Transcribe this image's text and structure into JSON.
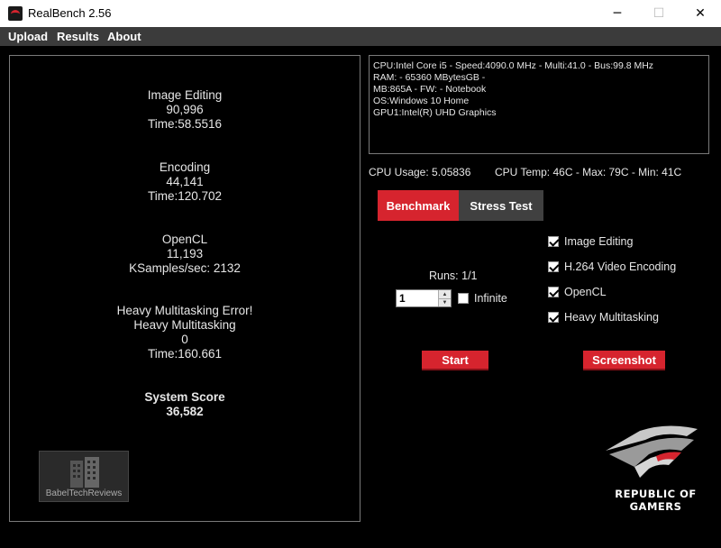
{
  "window": {
    "title": "RealBench 2.56",
    "min_glyph": "─",
    "max_glyph": "☐",
    "close_glyph": "✕"
  },
  "menu": [
    "Upload",
    "Results",
    "About"
  ],
  "results": {
    "image_editing": {
      "name": "Image Editing",
      "score": "90,996",
      "time": "Time:58.5516"
    },
    "encoding": {
      "name": "Encoding",
      "score": "44,141",
      "time": "Time:120.702"
    },
    "opencl": {
      "name": "OpenCL",
      "score": "11,193",
      "time": "KSamples/sec: 2132"
    },
    "heavy": {
      "error": "Heavy Multitasking Error!",
      "name": "Heavy Multitasking",
      "score": "0",
      "time": "Time:160.661"
    },
    "system": {
      "label": "System Score",
      "score": "36,582"
    }
  },
  "watermark": "BabelTechReviews",
  "sysinfo": [
    "CPU:Intel Core i5 - Speed:4090.0 MHz - Multi:41.0 - Bus:99.8 MHz",
    "RAM: - 65360 MBytesGB -",
    "MB:865A - FW: - Notebook",
    "OS:Windows 10 Home",
    "GPU1:Intel(R) UHD Graphics"
  ],
  "cpu_usage": "CPU Usage: 5.05836",
  "cpu_temp": "CPU Temp:  46C - Max:  79C - Min:  41C",
  "tabs": {
    "benchmark": "Benchmark",
    "stress": "Stress Test"
  },
  "checks": [
    {
      "label": "Image Editing",
      "checked": true
    },
    {
      "label": "H.264 Video Encoding",
      "checked": true
    },
    {
      "label": "OpenCL",
      "checked": true
    },
    {
      "label": "Heavy Multitasking",
      "checked": true
    }
  ],
  "runs": {
    "label": "Runs: 1/1",
    "value": "1",
    "infinite_label": "Infinite",
    "infinite_checked": false
  },
  "buttons": {
    "start": "Start",
    "screenshot": "Screenshot"
  },
  "brand": {
    "line1": "REPUBLIC OF",
    "line2": "GAMERS"
  },
  "colors": {
    "accent_red": "#d6242e",
    "tab_inactive": "#404040",
    "menu_bar": "#3b3b3b"
  }
}
